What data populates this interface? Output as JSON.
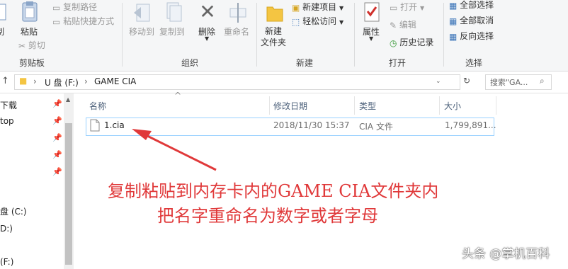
{
  "ribbon": {
    "clipboard": {
      "label": "剪贴板",
      "copy": "制",
      "paste": "粘贴",
      "copy_path": "复制路径",
      "paste_shortcut": "粘贴快捷方式",
      "cut": "剪切"
    },
    "organize": {
      "label": "组织",
      "move_to": "移动到",
      "copy_to": "复制到",
      "delete": "删除",
      "rename": "重命名"
    },
    "new": {
      "label": "新建",
      "new_folder": "新建\n文件夹",
      "new_item": "新建项目",
      "easy_access": "轻松访问"
    },
    "open": {
      "label": "打开",
      "properties": "属性",
      "open": "打开",
      "edit": "编辑",
      "history": "历史记录"
    },
    "select": {
      "label": "选择",
      "select_all": "全部选择",
      "select_none": "全部取消",
      "invert": "反向选择"
    }
  },
  "address": {
    "drive": "U 盘 (F:)",
    "folder": "GAME CIA",
    "search_placeholder": "搜索\"GA..."
  },
  "nav": {
    "items": [
      {
        "label": "下载"
      },
      {
        "label": "top"
      },
      {
        "label": "盘 (C:)"
      },
      {
        "label": "D:)"
      },
      {
        "label": "(F:)"
      }
    ]
  },
  "columns": {
    "name": "名称",
    "date": "修改日期",
    "type": "类型",
    "size": "大小"
  },
  "files": [
    {
      "name": "1.cia",
      "date": "2018/11/30 15:37",
      "type": "CIA 文件",
      "size": "1,799,891..."
    }
  ],
  "annotation": {
    "line1": "复制粘贴到内存卡内的GAME CIA文件夹内",
    "line2": "把名字重命名为数字或者字母",
    "color": "#e0393a"
  },
  "watermark": "头条 @掌机百科"
}
